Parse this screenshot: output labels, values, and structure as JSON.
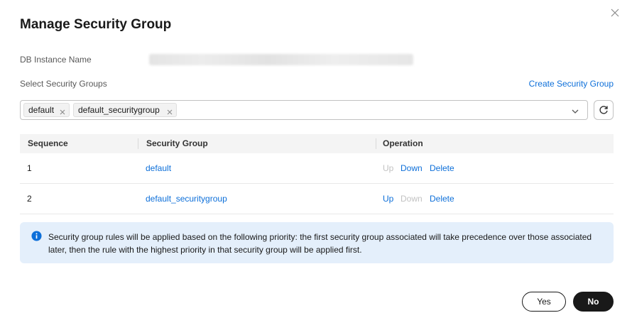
{
  "dialog": {
    "title": "Manage Security Group",
    "close_icon": "close-icon"
  },
  "form": {
    "instance_name_label": "DB Instance Name",
    "instance_name_value": "",
    "select_label": "Select Security Groups",
    "create_link": "Create Security Group",
    "selected_tags": [
      {
        "label": "default",
        "remove_icon": "close-icon"
      },
      {
        "label": "default_securitygroup",
        "remove_icon": "close-icon"
      }
    ],
    "dropdown_icon": "chevron-down-icon",
    "refresh_icon": "refresh-icon"
  },
  "table": {
    "headers": [
      "Sequence",
      "Security Group",
      "Operation"
    ],
    "rows": [
      {
        "sequence": "1",
        "group": "default",
        "up": "Up",
        "down": "Down",
        "delete": "Delete",
        "up_enabled": false,
        "down_enabled": true,
        "delete_enabled": true
      },
      {
        "sequence": "2",
        "group": "default_securitygroup",
        "up": "Up",
        "down": "Down",
        "delete": "Delete",
        "up_enabled": true,
        "down_enabled": false,
        "delete_enabled": true
      }
    ]
  },
  "notice": {
    "icon": "info-icon",
    "text": "Security group rules will be applied based on the following priority: the first security group associated will take precedence over those associated later, then the rule with the highest priority in that security group will be applied first."
  },
  "footer": {
    "yes_label": "Yes",
    "no_label": "No"
  },
  "colors": {
    "link": "#0d6fd9",
    "disabled": "#c2c2c2",
    "notice_bg": "#e4effb",
    "primary_button": "#191919"
  }
}
